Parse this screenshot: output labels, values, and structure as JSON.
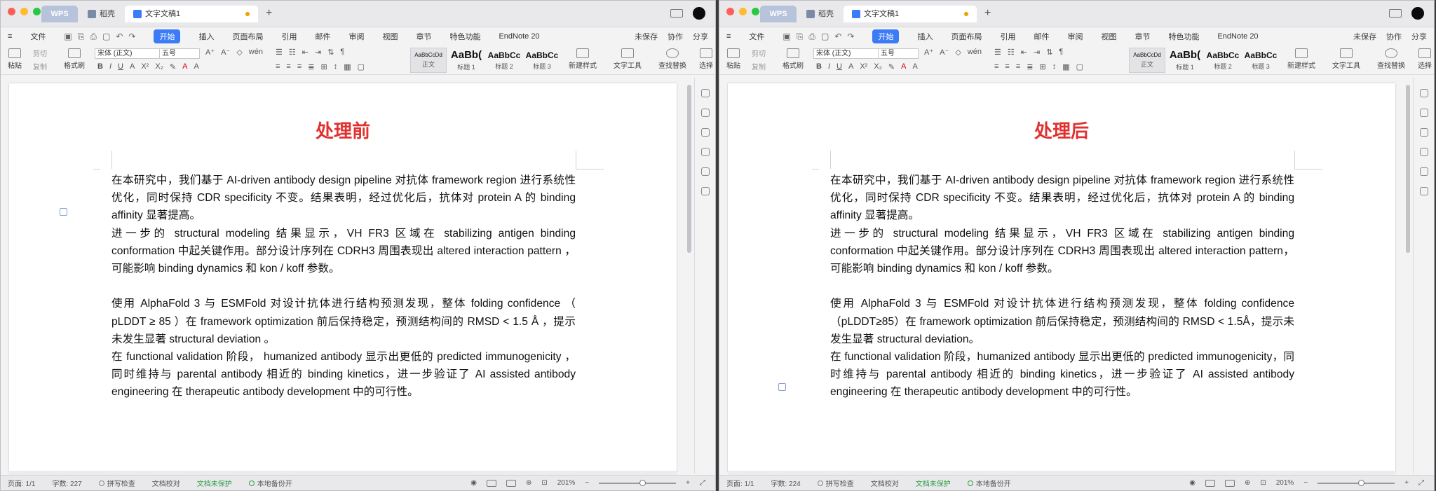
{
  "windows": [
    {
      "id": "left",
      "tabs": {
        "wps": "WPS",
        "t2": "稻壳",
        "doc": "文字文稿1"
      },
      "menu": [
        "文件",
        "开始",
        "插入",
        "页面布局",
        "引用",
        "邮件",
        "审阅",
        "视图",
        "章节",
        "特色功能",
        "EndNote 20"
      ],
      "menu_right": [
        "未保存",
        "协作",
        "分享"
      ],
      "ribbon": {
        "paste": "粘贴",
        "cut": "剪切",
        "copy": "复制",
        "format_painter": "格式刷",
        "font_name": "宋体 (正文)",
        "font_size": "五号",
        "styles": [
          {
            "sample": "AaBbCcDd",
            "name": "正文"
          },
          {
            "sample": "AaBb(",
            "name": "标题 1"
          },
          {
            "sample": "AaBbCc",
            "name": "标题 2"
          },
          {
            "sample": "AaBbCc",
            "name": "标题 3"
          }
        ],
        "new_style": "新建样式",
        "text_tools": "文字工具",
        "find_replace": "查找替换",
        "select": "选择"
      },
      "doc": {
        "heading": "处理前",
        "p1": "在本研究中，我们基于 AI-driven antibody design pipeline 对抗体 framework region 进行系统性优化，同时保持 CDR specificity 不变。结果表明，经过优化后，抗体对 protein A 的 binding affinity 显著提高。",
        "p2": "进一步的 structural modeling 结果显示，VH FR3 区域在 stabilizing antigen binding conformation 中起关键作用。部分设计序列在 CDRH3 周围表现出 altered interaction pattern ，可能影响 binding dynamics 和 kon / koff 参数。",
        "p3": "使用 AlphaFold 3 与 ESMFold 对设计抗体进行结构预测发现，整体 folding confidence （ pLDDT ≥ 85 ）在 framework optimization 前后保持稳定，预测结构间的 RMSD < 1.5 Å ，提示未发生显著 structural deviation 。",
        "p4": "在 functional validation 阶段， humanized antibody 显示出更低的 predicted immunogenicity ，同时维持与 parental antibody 相近的 binding kinetics，进一步验证了 AI assisted antibody engineering 在 therapeutic antibody development 中的可行性。"
      },
      "status": {
        "page": "页面: 1/1",
        "words": "字数: 227",
        "spell": "拼写检查",
        "proof": "文档校对",
        "protect": "文档未保护",
        "backup": "本地备份开",
        "zoom": "201%"
      }
    },
    {
      "id": "right",
      "tabs": {
        "wps": "WPS",
        "t2": "稻壳",
        "doc": "文字文稿1"
      },
      "menu": [
        "文件",
        "开始",
        "插入",
        "页面布局",
        "引用",
        "邮件",
        "审阅",
        "视图",
        "章节",
        "特色功能",
        "EndNote 20"
      ],
      "menu_right": [
        "未保存",
        "协作",
        "分享"
      ],
      "ribbon": {
        "paste": "粘贴",
        "cut": "剪切",
        "copy": "复制",
        "format_painter": "格式刷",
        "font_name": "宋体 (正文)",
        "font_size": "五号",
        "styles": [
          {
            "sample": "AaBbCcDd",
            "name": "正文"
          },
          {
            "sample": "AaBb(",
            "name": "标题 1"
          },
          {
            "sample": "AaBbCc",
            "name": "标题 2"
          },
          {
            "sample": "AaBbCc",
            "name": "标题 3"
          }
        ],
        "new_style": "新建样式",
        "text_tools": "文字工具",
        "find_replace": "查找替换",
        "select": "选择"
      },
      "doc": {
        "heading": "处理后",
        "p1": "在本研究中，我们基于 AI-driven antibody design pipeline 对抗体 framework region 进行系统性优化，同时保持 CDR specificity 不变。结果表明，经过优化后，抗体对 protein A 的 binding affinity 显著提高。",
        "p2": "进一步的 structural modeling 结果显示，VH FR3 区域在 stabilizing antigen binding conformation 中起关键作用。部分设计序列在 CDRH3 周围表现出 altered interaction pattern，可能影响 binding dynamics 和 kon / koff 参数。",
        "p3": "使用 AlphaFold 3 与 ESMFold 对设计抗体进行结构预测发现，整体 folding confidence（pLDDT≥85）在 framework optimization 前后保持稳定，预测结构间的 RMSD < 1.5Å，提示未发生显著 structural deviation。",
        "p4": "在 functional validation 阶段，humanized antibody 显示出更低的 predicted immunogenicity，同时维持与 parental antibody 相近的 binding kinetics，进一步验证了 AI assisted antibody engineering 在 therapeutic antibody development 中的可行性。"
      },
      "status": {
        "page": "页面: 1/1",
        "words": "字数: 224",
        "spell": "拼写检查",
        "proof": "文档校对",
        "protect": "文档未保护",
        "backup": "本地备份开",
        "zoom": "201%"
      }
    }
  ],
  "colors": {
    "accent": "#3b7cf6",
    "heading": "#e0312f",
    "protect_green": "#2f9e44"
  }
}
